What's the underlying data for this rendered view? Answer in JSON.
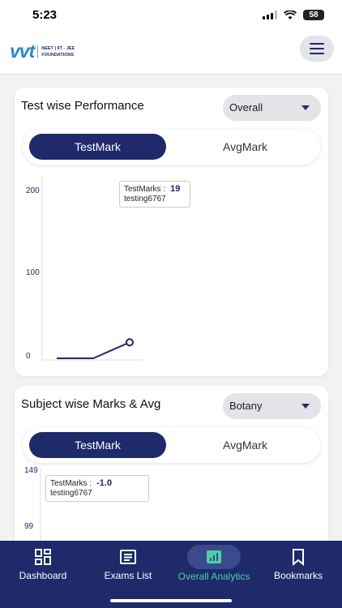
{
  "status": {
    "time": "5:23",
    "battery": "58"
  },
  "brand": {
    "mark": "vvt",
    "line1": "NEET | IIT - JEE",
    "line2": "FOUNDATIONS"
  },
  "colors": {
    "primary": "#1e2a6a",
    "accent_active": "#4fd0a4",
    "brand_blue": "#2a86c9"
  },
  "test_card": {
    "title": "Test wise Performance",
    "filter": "Overall",
    "tab_active": "TestMark",
    "tab_inactive": "AvgMark",
    "tooltip": {
      "label": "TestMarks :",
      "value": "19",
      "name": "testing6767"
    }
  },
  "subject_card": {
    "title": "Subject wise Marks & Avg",
    "filter": "Botany",
    "tab_active": "TestMark",
    "tab_inactive": "AvgMark",
    "tooltip": {
      "label": "TestMarks :",
      "value": "-1.0",
      "name": "testing6767"
    }
  },
  "chart_data": [
    {
      "type": "line",
      "title": "",
      "yticks": [
        "200",
        "100",
        "0"
      ],
      "ylim": [
        0,
        200
      ],
      "series": [
        {
          "values": [
            0,
            0,
            19
          ]
        }
      ]
    },
    {
      "type": "line",
      "title": "",
      "yticks": [
        "149",
        "99"
      ],
      "series": [
        {
          "values": [
            -1.0
          ]
        }
      ]
    }
  ],
  "nav": {
    "items": [
      {
        "label": "Dashboard",
        "icon": "dashboard-icon"
      },
      {
        "label": "Exams List",
        "icon": "list-icon"
      },
      {
        "label": "Overall Analytics",
        "icon": "analytics-icon"
      },
      {
        "label": "Bookmarks",
        "icon": "bookmark-icon"
      }
    ]
  }
}
